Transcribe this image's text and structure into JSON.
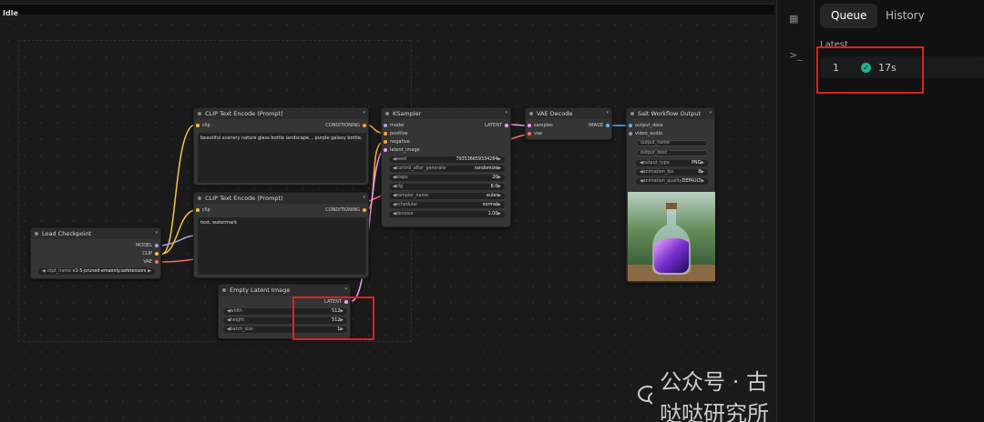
{
  "status": "Idle",
  "canvas": {
    "nodes": {
      "load_checkpoint": {
        "title": "Load Checkpoint",
        "outputs": [
          "MODEL",
          "CLIP",
          "VAE"
        ],
        "widget_label": "ckpt_name",
        "widget_value": "v1-5-pruned-emaonly.safetensors"
      },
      "clip_pos": {
        "title": "CLIP Text Encode (Prompt)",
        "input": "clip",
        "output": "CONDITIONING",
        "text": "beautiful scenery nature glass bottle landscape, , purple galaxy bottle,"
      },
      "clip_neg": {
        "title": "CLIP Text Encode (Prompt)",
        "input": "clip",
        "output": "CONDITIONING",
        "text": "text, watermark"
      },
      "empty_latent": {
        "title": "Empty Latent Image",
        "output": "LATENT",
        "widgets": [
          {
            "label": "width",
            "value": "512"
          },
          {
            "label": "height",
            "value": "512"
          },
          {
            "label": "batch_size",
            "value": "1"
          }
        ]
      },
      "ksampler": {
        "title": "KSampler",
        "inputs": [
          "model",
          "positive",
          "negative",
          "latent_image"
        ],
        "output": "LATENT",
        "widgets": [
          {
            "label": "seed",
            "value": "793536659334284"
          },
          {
            "label": "control_after_generate",
            "value": "randomize"
          },
          {
            "label": "steps",
            "value": "20"
          },
          {
            "label": "cfg",
            "value": "8.0"
          },
          {
            "label": "sampler_name",
            "value": "euler"
          },
          {
            "label": "scheduler",
            "value": "normal"
          },
          {
            "label": "denoise",
            "value": "1.00"
          }
        ]
      },
      "vae_decode": {
        "title": "VAE Decode",
        "inputs": [
          "samples",
          "vae"
        ],
        "output": "IMAGE"
      },
      "salt_output": {
        "title": "Salt Workflow Output",
        "inputs": [
          "output_data",
          "video_audio"
        ],
        "text_fields": [
          "output_name",
          "output_desc"
        ],
        "widgets": [
          {
            "label": "output_type",
            "value": "PNG"
          },
          {
            "label": "animation_fps",
            "value": "8"
          },
          {
            "label": "animation_quality",
            "value": "DEFAULT"
          }
        ]
      }
    }
  },
  "panel": {
    "tabs": [
      "Queue",
      "History"
    ],
    "active_tab": "Queue",
    "section_label": "Latest",
    "queue_items": [
      {
        "index": "1",
        "time": "17s"
      }
    ]
  },
  "watermark": "公众号 · 古哒哒研究所",
  "colors": {
    "model": "#b39ddb",
    "clip": "#f5c542",
    "vae": "#ff6e6e",
    "conditioning": "#ffa931",
    "latent": "#ff9cf9",
    "image": "#64b5f6",
    "accent_red": "#e02020",
    "success": "#22b38a"
  }
}
